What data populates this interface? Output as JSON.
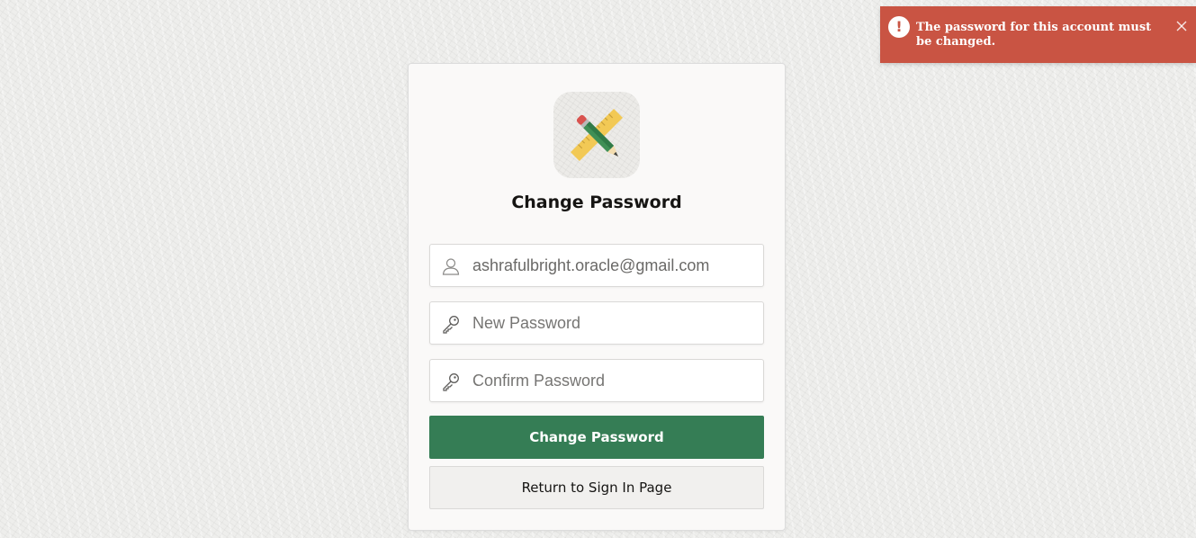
{
  "alert": {
    "message": "The password for this account must be changed.",
    "icon": "exclamation-icon",
    "close_icon": "close-icon",
    "color": "#c95443"
  },
  "card": {
    "app_icon": "pencil-ruler-icon",
    "title": "Change Password",
    "username": {
      "value": "ashrafulbright.oracle@gmail.com",
      "icon": "user-icon"
    },
    "new_password": {
      "placeholder": "New Password",
      "icon": "key-icon"
    },
    "confirm_password": {
      "placeholder": "Confirm Password",
      "icon": "key-icon"
    },
    "submit_label": "Change Password",
    "return_label": "Return to Sign In Page",
    "accent_color": "#357d55"
  }
}
